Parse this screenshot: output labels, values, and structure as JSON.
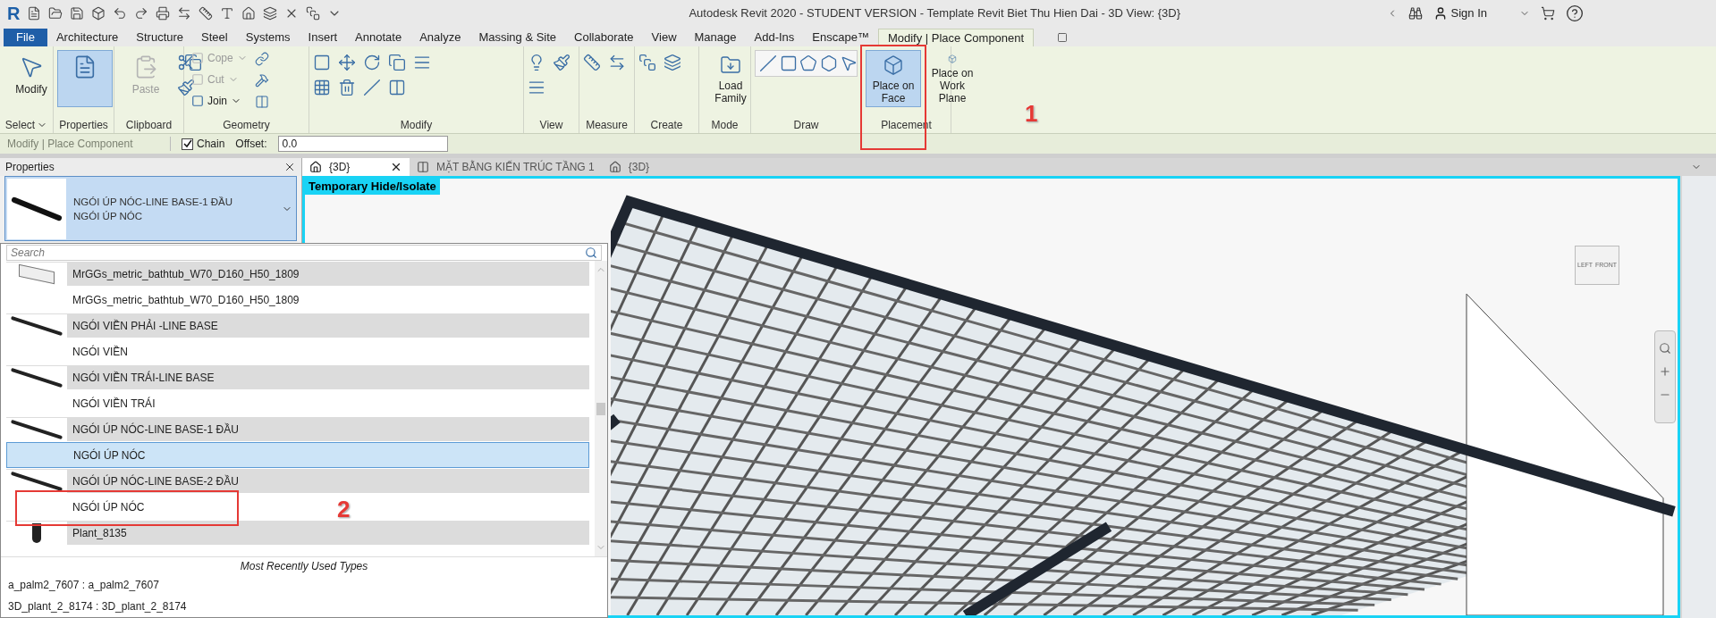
{
  "title_bar": {
    "app_logo": "R",
    "title": "Autodesk Revit 2020 - STUDENT VERSION - Template Revit Biet Thu Hien Dai - 3D View: {3D}",
    "sign_in": "Sign In"
  },
  "ribbon_tabs": [
    {
      "label": "File",
      "kind": "file",
      "selected": false
    },
    {
      "label": "Architecture",
      "kind": "tab",
      "selected": false
    },
    {
      "label": "Structure",
      "kind": "tab",
      "selected": false
    },
    {
      "label": "Steel",
      "kind": "tab",
      "selected": false
    },
    {
      "label": "Systems",
      "kind": "tab",
      "selected": false
    },
    {
      "label": "Insert",
      "kind": "tab",
      "selected": false
    },
    {
      "label": "Annotate",
      "kind": "tab",
      "selected": false
    },
    {
      "label": "Analyze",
      "kind": "tab",
      "selected": false
    },
    {
      "label": "Massing & Site",
      "kind": "tab",
      "selected": false
    },
    {
      "label": "Collaborate",
      "kind": "tab",
      "selected": false
    },
    {
      "label": "View",
      "kind": "tab",
      "selected": false
    },
    {
      "label": "Manage",
      "kind": "tab",
      "selected": false
    },
    {
      "label": "Add-Ins",
      "kind": "tab",
      "selected": false
    },
    {
      "label": "Enscape™",
      "kind": "tab",
      "selected": false
    },
    {
      "label": "Modify | Place Component",
      "kind": "contextual",
      "selected": true
    }
  ],
  "ribbon_panels": [
    {
      "label": "Select",
      "dropdown": true,
      "tools": [
        {
          "kind": "large",
          "label": "Modify",
          "disabled": false,
          "selected": false
        }
      ]
    },
    {
      "label": "Properties",
      "tools": [
        {
          "kind": "large-icon",
          "disabled": false,
          "selected": true
        }
      ]
    },
    {
      "label": "Clipboard",
      "tools": [
        {
          "kind": "large",
          "label": "Paste",
          "disabled": true,
          "selected": false
        }
      ]
    },
    {
      "label": "Geometry",
      "tools": [
        {
          "kind": "small",
          "label": "Cope",
          "disabled": true,
          "selected": false
        },
        {
          "kind": "small",
          "label": "Cut",
          "disabled": true,
          "selected": false
        },
        {
          "kind": "small",
          "label": "Join",
          "disabled": false,
          "selected": false
        }
      ]
    },
    {
      "label": "Modify"
    },
    {
      "label": "View"
    },
    {
      "label": "Measure"
    },
    {
      "label": "Create"
    },
    {
      "label": "Mode",
      "tools": [
        {
          "kind": "large",
          "label": "Load Family",
          "disabled": false,
          "selected": false
        }
      ]
    },
    {
      "label": "Draw"
    },
    {
      "label": "Placement",
      "tools": [
        {
          "kind": "large",
          "label": "Place on Face",
          "disabled": false,
          "selected": true,
          "marked": true,
          "note": "1"
        },
        {
          "kind": "large",
          "label": "Place on Work Plane",
          "disabled": false,
          "selected": false
        }
      ]
    }
  ],
  "options_bar": {
    "context": "Modify | Place Component",
    "chain": {
      "label": "Chain",
      "checked": true
    },
    "offset": {
      "label": "Offset:",
      "value": "0.0"
    }
  },
  "properties": {
    "title": "Properties",
    "type_selector": {
      "family": "NGÓI ÚP NÓC-LINE BASE-1 ĐẦU",
      "type": "NGÓI ÚP NÓC"
    },
    "search": {
      "placeholder": "Search"
    },
    "types": [
      {
        "name": "MrGGs_metric_bathtub_W70_D160_H50_1809",
        "kind": "bathtub-family",
        "selected": false
      },
      {
        "name": "MrGGs_metric_bathtub_W70_D160_H50_1809",
        "kind": "type",
        "selected": false
      },
      {
        "name": "NGÓI VIỀN PHẢI -LINE BASE",
        "kind": "bar-family",
        "selected": false
      },
      {
        "name": "NGÓI VIỀN",
        "kind": "type",
        "selected": false
      },
      {
        "name": "NGÓI VIỀN TRÁI-LINE BASE",
        "kind": "bar-family",
        "selected": false
      },
      {
        "name": "NGÓI VIỀN TRÁI",
        "kind": "type",
        "selected": false
      },
      {
        "name": "NGÓI ÚP NÓC-LINE BASE-1 ĐẦU",
        "kind": "bar-family",
        "selected": false
      },
      {
        "name": "NGÓI ÚP NÓC",
        "kind": "type",
        "selected": true
      },
      {
        "name": "NGÓI ÚP NÓC-LINE BASE-2 ĐẦU",
        "kind": "bar-family",
        "selected": false
      },
      {
        "name": "NGÓI ÚP NÓC",
        "kind": "type",
        "selected": false,
        "marked": true,
        "note": "2"
      },
      {
        "name": "Plant_8135",
        "kind": "plant-family",
        "selected": false
      }
    ],
    "recent_heading": "Most Recently Used Types",
    "recent": [
      "a_palm2_7607 : a_palm2_7607",
      "3D_plant_2_8174 : 3D_plant_2_8174"
    ]
  },
  "view_tabs": [
    {
      "label": "{3D}",
      "kind": "model",
      "selected": true
    },
    {
      "label": "MẶT BẰNG KIẾN TRÚC TẦNG 1",
      "kind": "plan",
      "selected": false
    },
    {
      "label": "{3D}",
      "kind": "model",
      "selected": false
    }
  ],
  "view": {
    "banner": "Temporary Hide/Isolate",
    "view_cube": {
      "left": "LEFT",
      "front": "FRONT"
    }
  }
}
